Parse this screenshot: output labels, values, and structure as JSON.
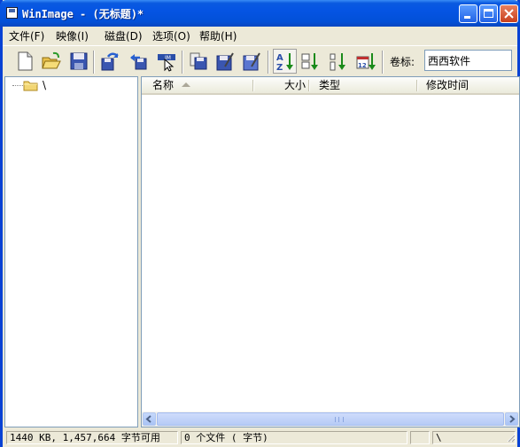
{
  "titlebar": {
    "title": "WinImage - (无标题)*"
  },
  "menu": [
    {
      "label": "文件(F)"
    },
    {
      "label": "映像(I)"
    },
    {
      "label": "磁盘(D)"
    },
    {
      "label": "选项(O)"
    },
    {
      "label": "帮助(H)"
    }
  ],
  "toolbar": {
    "volume_label": "卷标:",
    "volume_value": "西西软件"
  },
  "tree": {
    "root_label": "\\"
  },
  "list": {
    "columns": [
      {
        "label": "名称"
      },
      {
        "label": "大小"
      },
      {
        "label": "类型"
      },
      {
        "label": "修改时间"
      }
    ],
    "rows": []
  },
  "statusbar": {
    "capacity": "1440 KB, 1,457,664 字节可用",
    "files": "0 个文件 ( 字节)",
    "empty": "",
    "path": "\\"
  },
  "colors": {
    "titlebar": "#0554e3",
    "window_bg": "#ece9d8"
  }
}
